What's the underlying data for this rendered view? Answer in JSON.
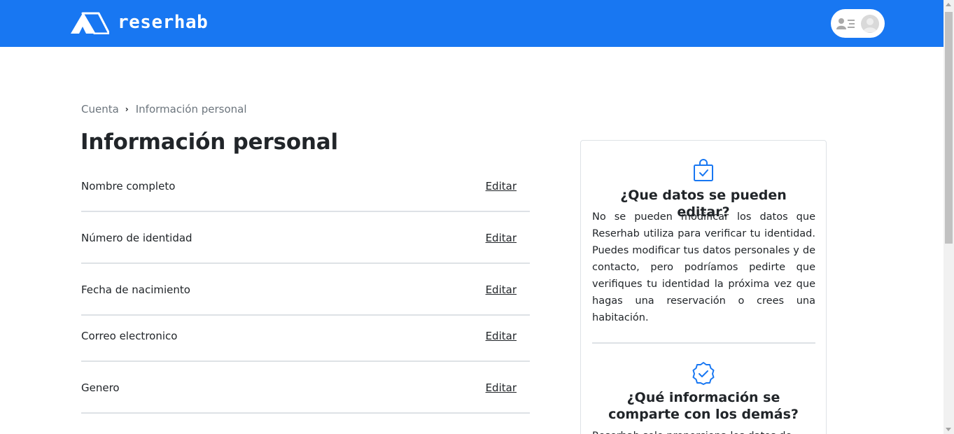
{
  "header": {
    "brand": "reserhab",
    "colors": {
      "bar": "#1877f2",
      "text": "#ffffff"
    },
    "icons": {
      "logo": "tent-logo-icon",
      "menu": "menu-lines-icon",
      "avatar": "user-avatar-icon"
    }
  },
  "breadcrumb": {
    "items": [
      "Cuenta",
      "Información personal"
    ],
    "separator_icon": "chevron-right-icon"
  },
  "page": {
    "title": "Información personal"
  },
  "fields": [
    {
      "label": "Nombre completo",
      "action": "Editar"
    },
    {
      "label": "Número de identidad",
      "action": "Editar"
    },
    {
      "label": "Fecha de nacimiento",
      "action": "Editar"
    },
    {
      "label": "Correo electronico",
      "action": "Editar"
    },
    {
      "label": "Genero",
      "action": "Editar"
    }
  ],
  "info_card": {
    "sections": [
      {
        "icon": "shopping-bag-check-icon",
        "title": "¿Que datos se pueden editar?",
        "body": "No se pueden modificar los datos que Reserhab utiliza para verificar tu identidad. Puedes modificar tus datos personales y de contacto, pero podríamos pedirte que verifiques tu identidad la próxima vez que hagas una reservación o crees una habitación."
      },
      {
        "icon": "badge-check-icon",
        "title": "¿Qué información se comparte con los demás?",
        "body": "Reserhab solo proporciona los datos de"
      }
    ],
    "accent_color": "#1877f2"
  }
}
